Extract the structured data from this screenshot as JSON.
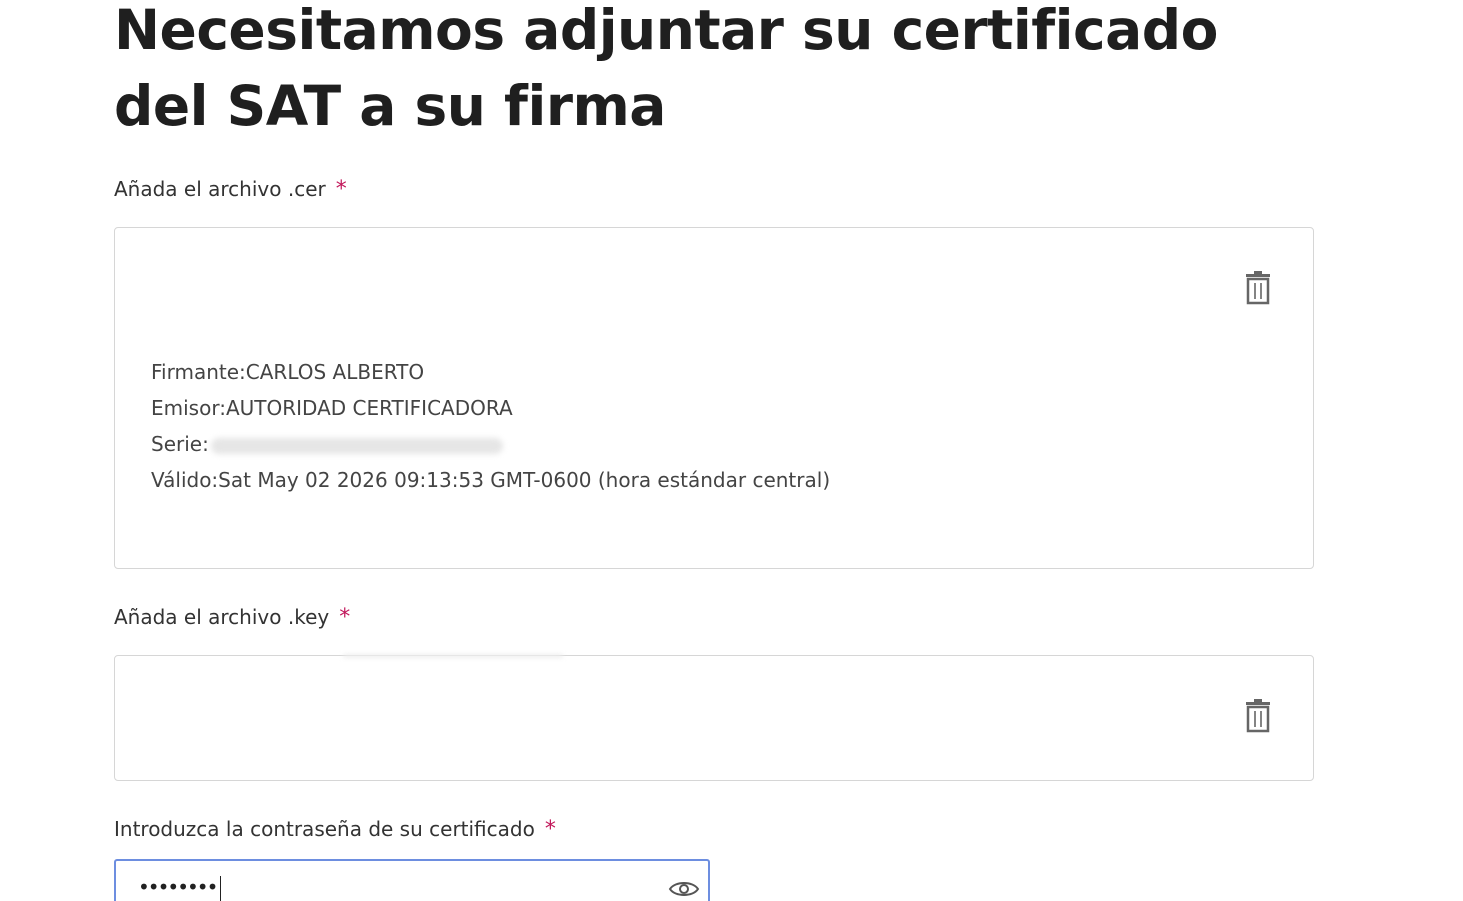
{
  "page": {
    "title": "Necesitamos adjuntar su certificado del SAT a su firma"
  },
  "cer_field": {
    "label": "Añada el archivo .cer",
    "required_mark": "*",
    "delete_icon": "trash-icon",
    "certificate": {
      "signer_label": "Firmante:",
      "signer_value": "CARLOS ALBERTO",
      "issuer_label": "Emisor:",
      "issuer_value": "AUTORIDAD CERTIFICADORA",
      "serial_label": "Serie:",
      "valid_label": "Válido:",
      "valid_value": "Sat May 02 2026 09:13:53 GMT-0600 (hora estándar central)"
    }
  },
  "key_field": {
    "label": "Añada el archivo .key",
    "required_mark": "*",
    "delete_icon": "trash-icon"
  },
  "password_field": {
    "label": "Introduzca la contraseña de su certificado",
    "required_mark": "*",
    "masked_value": "••••••••",
    "toggle_icon": "eye-icon"
  },
  "colors": {
    "required": "#c2185b",
    "focus_border": "#6d8ee0",
    "box_border": "#d6d6d6"
  }
}
